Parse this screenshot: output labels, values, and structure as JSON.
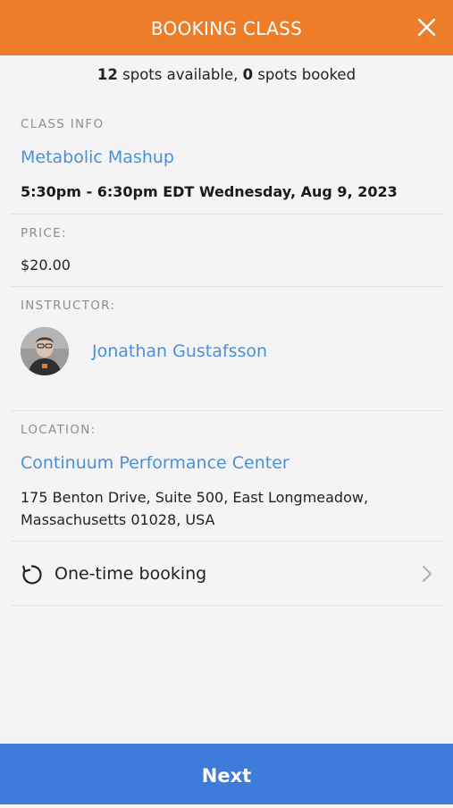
{
  "header": {
    "title": "BOOKING CLASS",
    "close_icon": "close-icon",
    "color": "#ee7d29"
  },
  "availability": {
    "spots_available_count": "12",
    "spots_available_text": "spots available,",
    "spots_booked_count": "0",
    "spots_booked_text": "spots booked"
  },
  "class_info": {
    "label": "CLASS INFO",
    "name": "Metabolic Mashup",
    "schedule": "5:30pm - 6:30pm EDT Wednesday, Aug 9, 2023"
  },
  "price": {
    "label": "PRICE:",
    "value": "$20.00"
  },
  "instructor": {
    "label": "INSTRUCTOR:",
    "name": "Jonathan Gustafsson",
    "avatar_icon": "avatar"
  },
  "location": {
    "label": "LOCATION:",
    "name": "Continuum Performance Center",
    "address_line1": "175 Benton Drive, Suite 500, East Longmeadow,",
    "address_line2": "Massachusetts 01028, USA"
  },
  "booking_type": {
    "icon": "refresh-icon",
    "label": "One-time booking",
    "chevron_icon": "chevron-right-icon"
  },
  "footer": {
    "next_label": "Next",
    "color": "#3f7bd8"
  },
  "colors": {
    "link": "#4a90d9",
    "section_label": "#8e8e8e",
    "background": "#f4f4f4"
  }
}
